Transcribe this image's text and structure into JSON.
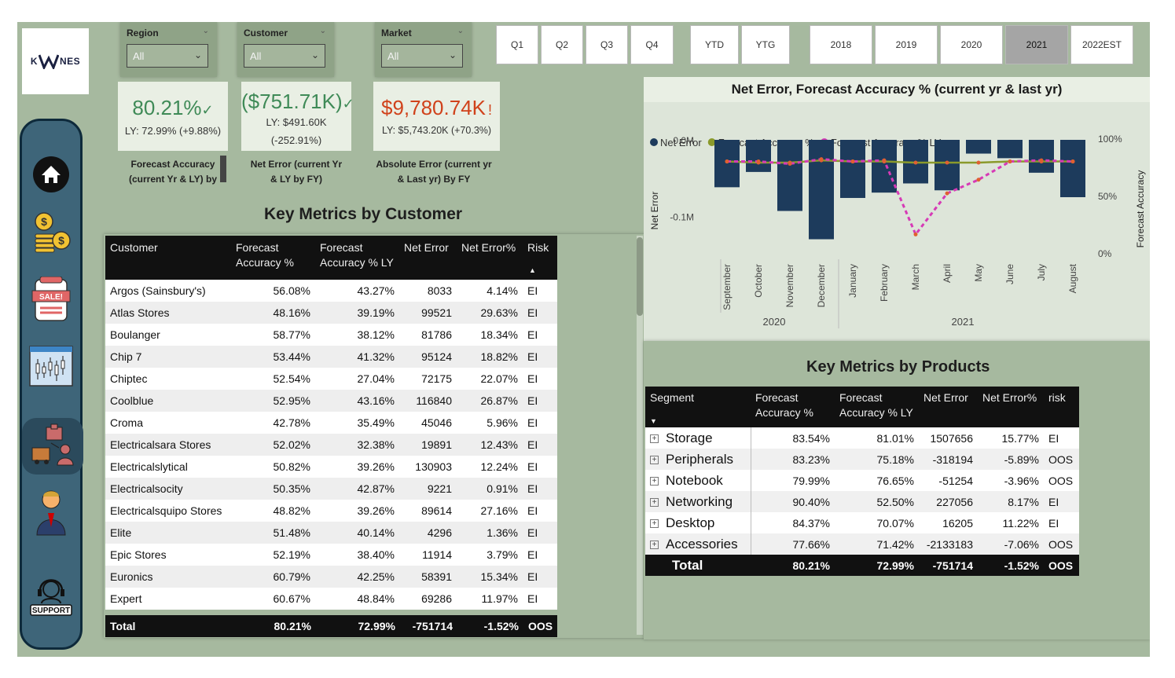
{
  "logo": {
    "text_left": "K",
    "text_right": "NES"
  },
  "filters": [
    {
      "label": "Region",
      "value": "All"
    },
    {
      "label": "Customer",
      "value": "All"
    },
    {
      "label": "Market",
      "value": "All"
    }
  ],
  "quarters": [
    "Q1",
    "Q2",
    "Q3",
    "Q4"
  ],
  "periods": [
    "YTD",
    "YTG"
  ],
  "years": [
    "2018",
    "2019",
    "2020",
    "2021",
    "2022EST"
  ],
  "selected_year": "2021",
  "kpis": [
    {
      "value": "80.21%",
      "mark": "✓",
      "sub1": "LY: 72.99% (+9.88%)",
      "sub2": "",
      "caption1": "Forecast Accuracy",
      "caption2": "(current Yr & LY) by",
      "color": "#3f8a57"
    },
    {
      "value": "($751.71K)",
      "mark": "✓",
      "sub1": "LY: $491.60K",
      "sub2": "(-252.91%)",
      "caption1": "Net Error (current Yr",
      "caption2": "& LY by FY)",
      "color": "#3f8a57"
    },
    {
      "value": "$9,780.74K",
      "mark": "!",
      "sub1": "LY: $5,743.20K (+70.3%)",
      "sub2": "",
      "caption1": "Absolute Error (current yr",
      "caption2": "& Last yr) By FY",
      "color": "#d0421b"
    }
  ],
  "customer_section": {
    "title": "Key Metrics by Customer",
    "headers": [
      "Customer",
      "Forecast Accuracy %",
      "Forecast Accuracy % LY",
      "Net Error",
      "Net Error%",
      "Risk"
    ],
    "rows": [
      [
        "Argos (Sainsbury's)",
        "56.08%",
        "43.27%",
        "8033",
        "4.14%",
        "EI"
      ],
      [
        "Atlas Stores",
        "48.16%",
        "39.19%",
        "99521",
        "29.63%",
        "EI"
      ],
      [
        "Boulanger",
        "58.77%",
        "38.12%",
        "81786",
        "18.34%",
        "EI"
      ],
      [
        "Chip 7",
        "53.44%",
        "41.32%",
        "95124",
        "18.82%",
        "EI"
      ],
      [
        "Chiptec",
        "52.54%",
        "27.04%",
        "72175",
        "22.07%",
        "EI"
      ],
      [
        "Coolblue",
        "52.95%",
        "43.16%",
        "116840",
        "26.87%",
        "EI"
      ],
      [
        "Croma",
        "42.78%",
        "35.49%",
        "45046",
        "5.96%",
        "EI"
      ],
      [
        "Electricalsara Stores",
        "52.02%",
        "32.38%",
        "19891",
        "12.43%",
        "EI"
      ],
      [
        "Electricalslytical",
        "50.82%",
        "39.26%",
        "130903",
        "12.24%",
        "EI"
      ],
      [
        "Electricalsocity",
        "50.35%",
        "42.87%",
        "9221",
        "0.91%",
        "EI"
      ],
      [
        "Electricalsquipo Stores",
        "48.82%",
        "39.26%",
        "89614",
        "27.16%",
        "EI"
      ],
      [
        "Elite",
        "51.48%",
        "40.14%",
        "4296",
        "1.36%",
        "EI"
      ],
      [
        "Epic Stores",
        "52.19%",
        "38.40%",
        "11914",
        "3.79%",
        "EI"
      ],
      [
        "Euronics",
        "60.79%",
        "42.25%",
        "58391",
        "15.34%",
        "EI"
      ],
      [
        "Expert",
        "60.67%",
        "48.84%",
        "69286",
        "11.97%",
        "EI"
      ]
    ],
    "total": [
      "Total",
      "80.21%",
      "72.99%",
      "-751714",
      "-1.52%",
      "OOS"
    ]
  },
  "product_section": {
    "title": "Key Metrics by Products",
    "headers": [
      "Segment",
      "Forecast Accuracy %",
      "Forecast Accuracy % LY",
      "Net Error",
      "Net Error%",
      "risk"
    ],
    "rows": [
      [
        "Storage",
        "83.54%",
        "81.01%",
        "1507656",
        "15.77%",
        "EI"
      ],
      [
        "Peripherals",
        "83.23%",
        "75.18%",
        "-318194",
        "-5.89%",
        "OOS"
      ],
      [
        "Notebook",
        "79.99%",
        "76.65%",
        "-51254",
        "-3.96%",
        "OOS"
      ],
      [
        "Networking",
        "90.40%",
        "52.50%",
        "227056",
        "8.17%",
        "EI"
      ],
      [
        "Desktop",
        "84.37%",
        "70.07%",
        "16205",
        "11.22%",
        "EI"
      ],
      [
        "Accessories",
        "77.66%",
        "71.42%",
        "-2133183",
        "-7.06%",
        "OOS"
      ]
    ],
    "total": [
      "Total",
      "80.21%",
      "72.99%",
      "-751714",
      "-1.52%",
      "OOS"
    ]
  },
  "chart_data": {
    "type": "bar",
    "title": "Net Error, Forecast Accuracy % (current yr & last yr)",
    "categories": [
      "September",
      "October",
      "November",
      "December",
      "January",
      "February",
      "March",
      "April",
      "May",
      "June",
      "July",
      "August"
    ],
    "year_groups": [
      {
        "label": "2020",
        "from": 0,
        "to": 3
      },
      {
        "label": "2021",
        "from": 4,
        "to": 11
      }
    ],
    "series": [
      {
        "name": "Net Error",
        "kind": "bar",
        "axis": "left",
        "color": "#1d3b5c",
        "values": [
          -0.062,
          -0.042,
          -0.093,
          -0.13,
          -0.076,
          -0.069,
          -0.057,
          -0.066,
          -0.018,
          -0.024,
          -0.043,
          -0.075
        ]
      },
      {
        "name": "Forecast Accuracy %",
        "kind": "line",
        "axis": "right",
        "color": "#8a9a2b",
        "values": [
          81,
          80,
          80,
          82,
          81,
          81,
          80,
          80,
          80,
          81,
          81,
          81
        ]
      },
      {
        "name": "Forecast Accuracy % LY",
        "kind": "line",
        "dashed": true,
        "axis": "right",
        "color": "#d63ab6",
        "values": [
          81,
          81,
          79,
          83,
          81,
          82,
          17,
          53,
          65,
          81,
          82,
          81
        ]
      }
    ],
    "ylabel": "Net Error",
    "y2label": "Forecast Accuracy",
    "yticks": [
      "0.0M",
      "-0.1M"
    ],
    "y2ticks": [
      "100%",
      "50%",
      "0%"
    ],
    "ylim": [
      -0.15,
      0.0
    ],
    "y2lim": [
      0,
      100
    ],
    "legend": "top-left",
    "grid": false
  }
}
